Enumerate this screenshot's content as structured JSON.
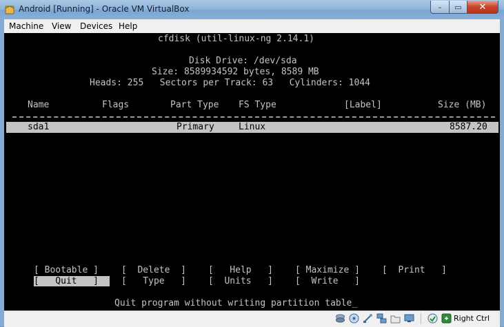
{
  "window": {
    "title": "Android [Running] - Oracle VM VirtualBox",
    "minimize": "–",
    "maximize": "▭",
    "close": "✕"
  },
  "menu": [
    "Machine",
    "View",
    "Devices",
    "Help"
  ],
  "console": {
    "header": "cfdisk (util-linux-ng 2.14.1)",
    "disk_drive": "Disk Drive: /dev/sda",
    "size": "Size: 8589934592 bytes, 8589 MB",
    "geometry": "Heads: 255   Sectors per Track: 63   Cylinders: 1044",
    "columns": {
      "name": "Name",
      "flags": "Flags",
      "part_type": "Part Type",
      "fs_type": "FS Type",
      "label": "[Label]",
      "size": "Size (MB)"
    },
    "partitions": [
      {
        "name": "sda1",
        "flags": "",
        "part_type": "Primary",
        "fs_type": "Linux",
        "label": "",
        "size": "8587.20"
      }
    ],
    "buttons_row1": [
      "[ Bootable ]",
      "[  Delete  ]",
      "[   Help   ]",
      "[ Maximize ]",
      "[  Print   ]"
    ],
    "buttons_row2": [
      "[   Quit   ]",
      "[   Type   ]",
      "[  Units   ]",
      "[  Write   ]"
    ],
    "status": "Quit program without writing partition table_"
  },
  "statusbar": {
    "icons": [
      "hard-disk-icon",
      "cd-icon",
      "usb-icon",
      "network-icon",
      "shared-folder-icon",
      "display-icon",
      "capture-icon",
      "keyboard-icon"
    ],
    "host_key": "Right Ctrl"
  }
}
